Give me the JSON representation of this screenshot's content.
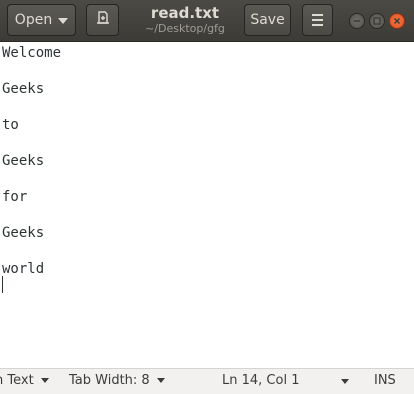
{
  "header": {
    "open_label": "Open",
    "save_label": "Save",
    "title": "read.txt",
    "subtitle": "~/Desktop/gfg",
    "icons": {
      "open_caret": "chevron-down-icon",
      "new_document": "new-document-icon",
      "menu": "hamburger-menu-icon",
      "minimize": "minimize-icon",
      "maximize": "maximize-icon",
      "close": "close-icon"
    }
  },
  "editor": {
    "lines": [
      "Welcome",
      "",
      "Geeks",
      "",
      "to",
      "",
      "Geeks",
      "",
      "for",
      "",
      "Geeks",
      "",
      "world",
      ""
    ]
  },
  "statusbar": {
    "language": "n Text",
    "tab_width": "Tab Width: 8",
    "position": "Ln 14, Col 1",
    "insert_mode": "INS"
  },
  "colors": {
    "headerbar": "#3c3b37",
    "close_button": "#e0541f",
    "text": "#2e3436",
    "statusbar": "#f2f1f0"
  }
}
